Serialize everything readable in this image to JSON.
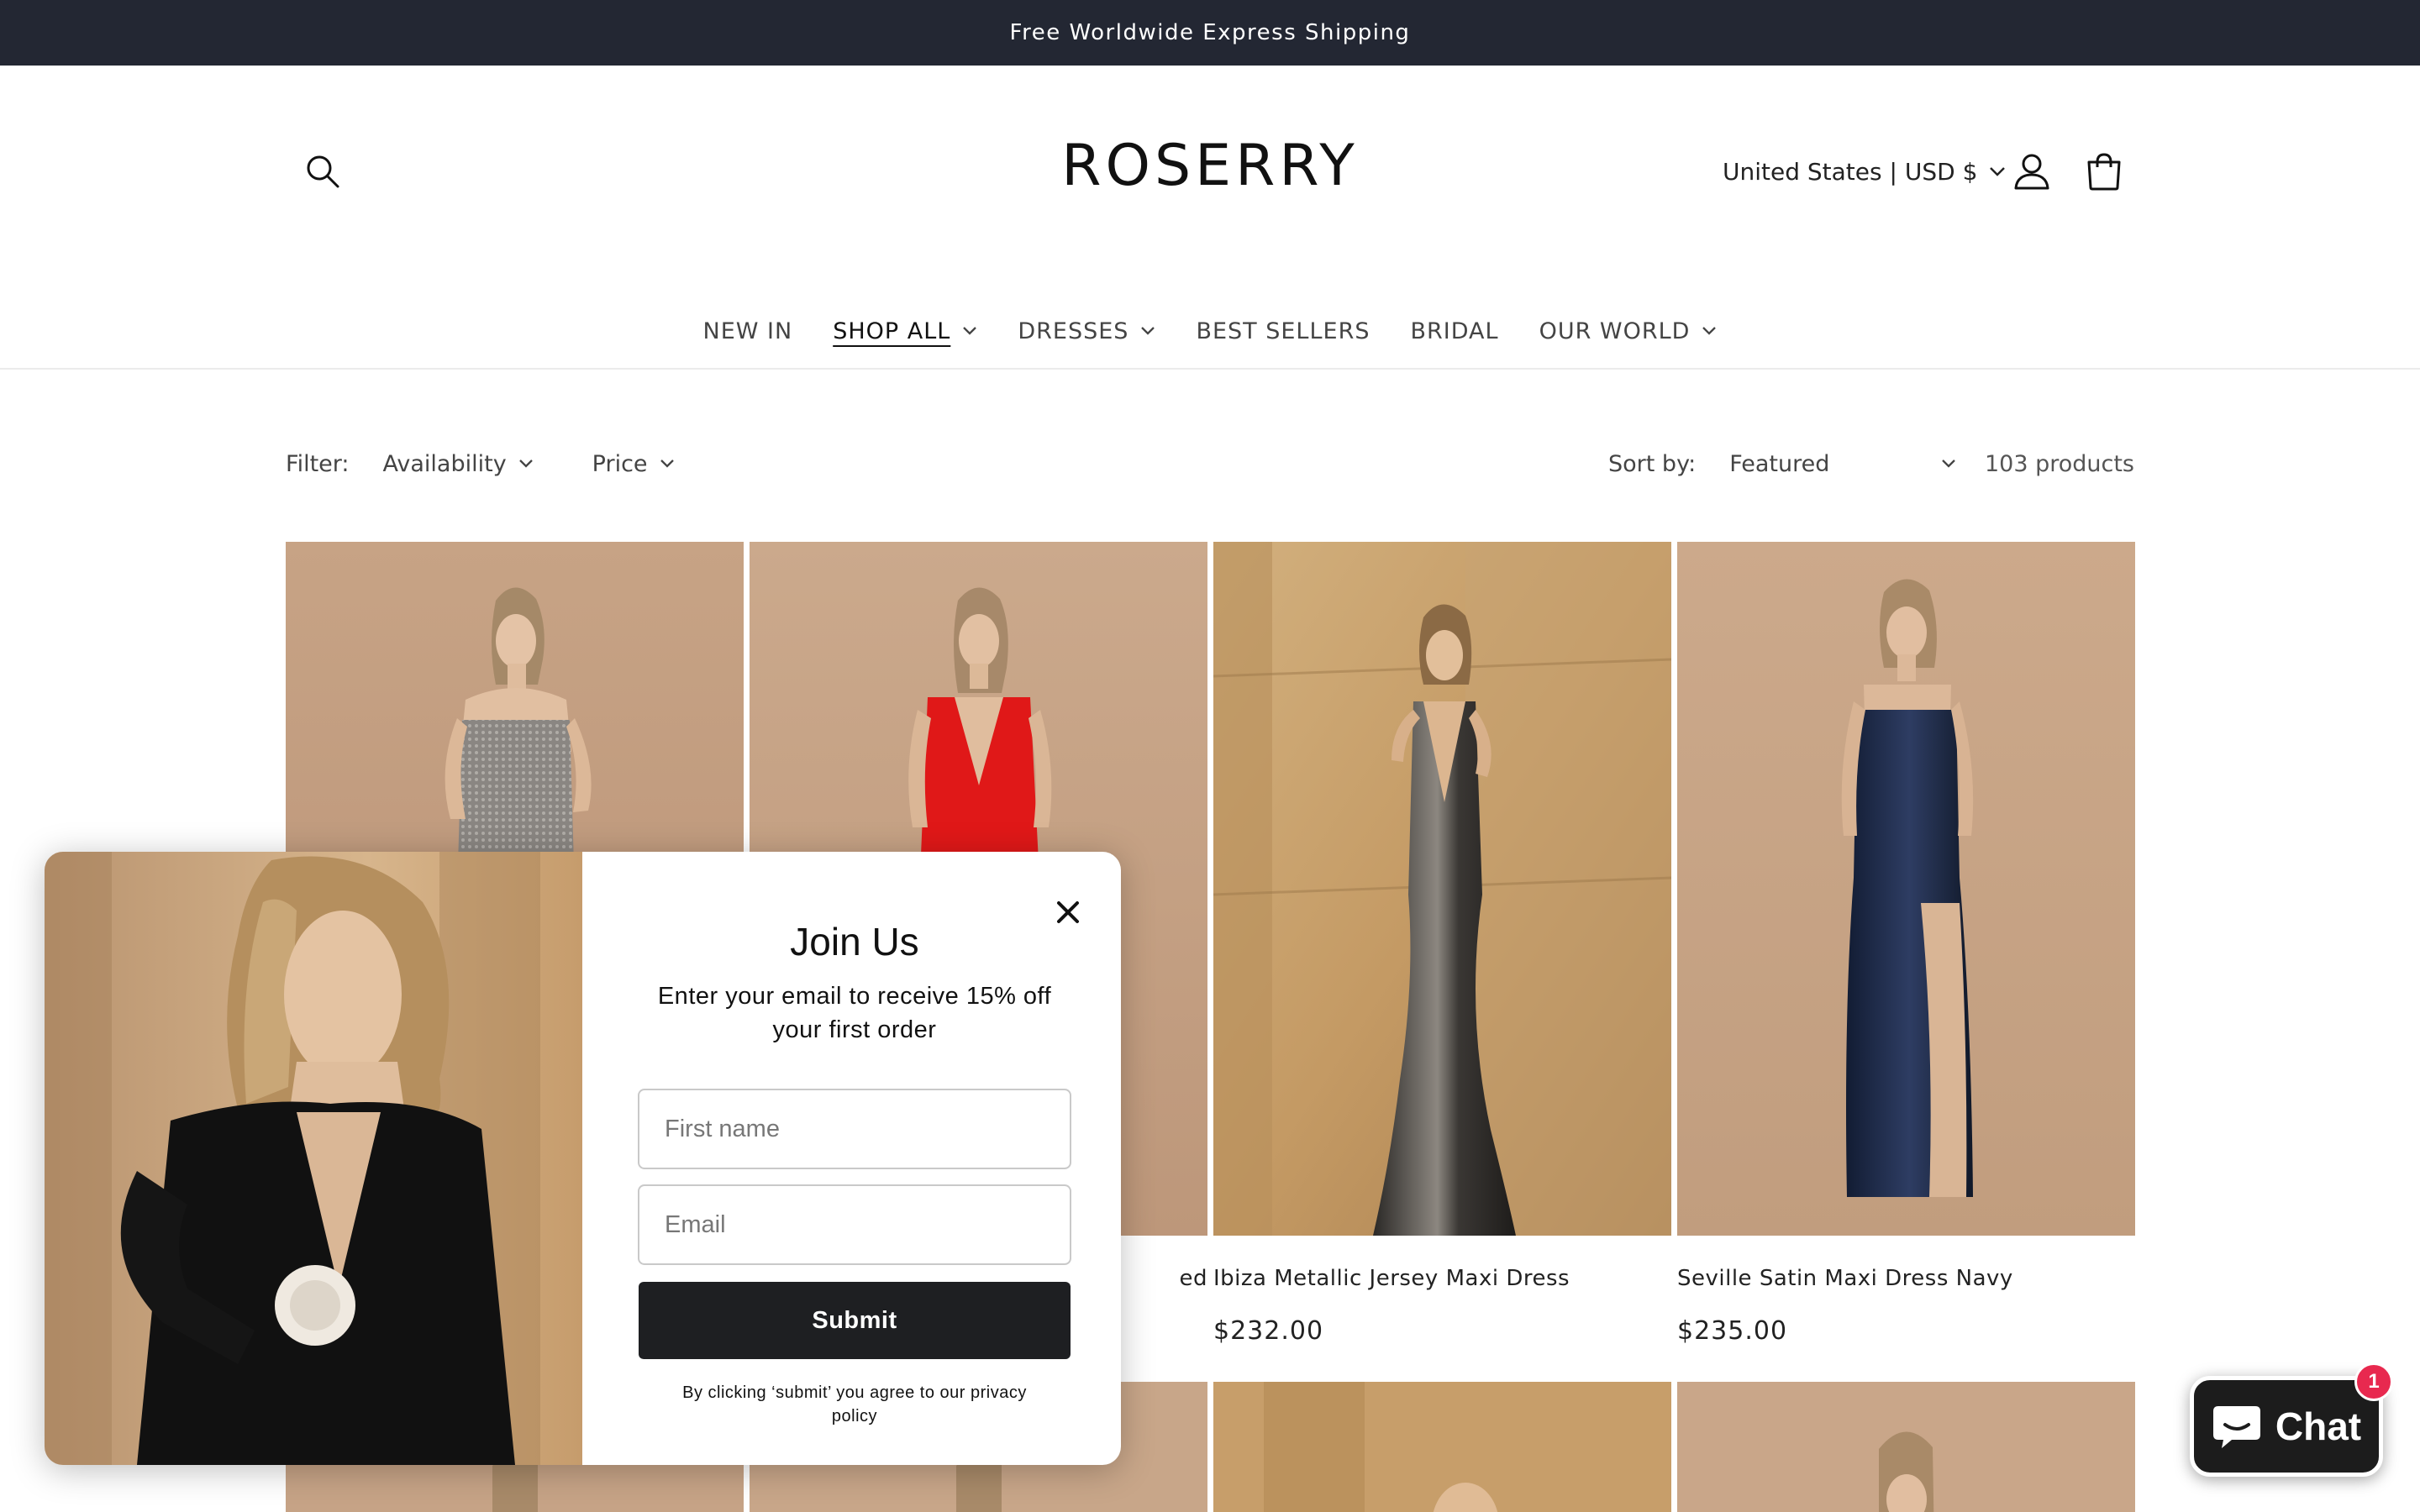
{
  "announcement": {
    "text": "Free Worldwide Express Shipping"
  },
  "header": {
    "logo": "ROSERRY",
    "currency": "United States | USD $",
    "nav": [
      {
        "label": "NEW IN",
        "has_dropdown": false
      },
      {
        "label": "SHOP ALL",
        "has_dropdown": true,
        "active": true
      },
      {
        "label": "DRESSES",
        "has_dropdown": true
      },
      {
        "label": "BEST SELLERS",
        "has_dropdown": false
      },
      {
        "label": "BRIDAL",
        "has_dropdown": false
      },
      {
        "label": "OUR WORLD",
        "has_dropdown": true
      }
    ]
  },
  "filters": {
    "filter_label": "Filter:",
    "availability": "Availability",
    "price": "Price",
    "sort_label": "Sort by:",
    "sort_value": "Featured",
    "product_count": "103 products"
  },
  "products": [
    {
      "title": "",
      "price": "",
      "image": "model in strapless silver sequin dress",
      "partial_title": ""
    },
    {
      "title": "",
      "price": "",
      "image": "model in red plunge neck dress",
      "partial_title": "ed"
    },
    {
      "title": "Ibiza Metallic Jersey Maxi Dress",
      "price": "$232.00",
      "image": "model in metallic gunmetal halter maxi dress"
    },
    {
      "title": "Seville Satin Maxi Dress Navy",
      "price": "$235.00",
      "image": "model in navy satin slit maxi dress"
    }
  ],
  "popup": {
    "title": "Join Us",
    "subtitle": "Enter your email to receive 15% off your first order",
    "first_name_placeholder": "First name",
    "email_placeholder": "Email",
    "submit_label": "Submit",
    "legal": "By clicking ‘submit’ you agree to our privacy policy"
  },
  "chat": {
    "label": "Chat",
    "badge": "1"
  },
  "colors": {
    "announcement_bg": "#232733",
    "accent_dark": "#1e1f22",
    "badge": "#e8294f",
    "photo_bg": "#c9a487"
  }
}
